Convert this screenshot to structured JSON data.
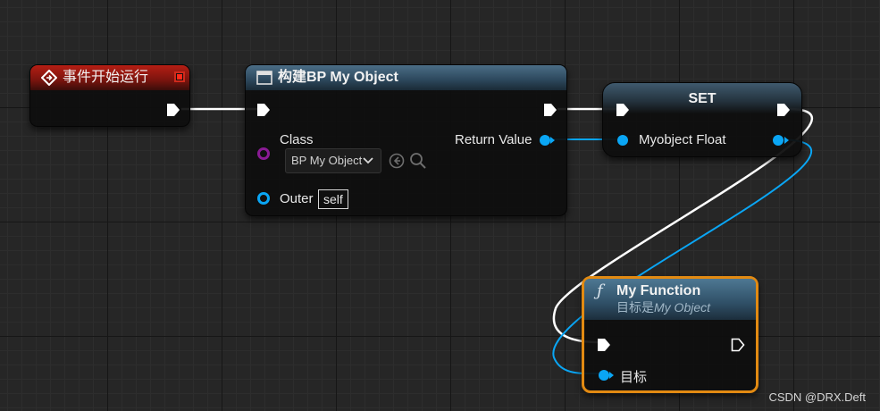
{
  "nodes": {
    "event": {
      "title": "事件开始运行"
    },
    "construct": {
      "title": "构建BP My Object",
      "class_label": "Class",
      "class_value": "BP My Object",
      "outer_label": "Outer",
      "outer_value": "self",
      "return_label": "Return Value"
    },
    "set": {
      "title": "SET",
      "var_label": "Myobject Float"
    },
    "func": {
      "title": "My Function",
      "subtitle_prefix": "目标是",
      "subtitle_target": "My Object",
      "target_label": "目标"
    }
  },
  "watermark": "CSDN @DRX.Deft",
  "colors": {
    "exec_wire": "#ffffff",
    "object_pin": "#0aa6f5",
    "class_pin": "#8a1b94",
    "event_header": "#b51e14",
    "func_border": "#e28a12"
  },
  "icons": {
    "event": "event-diamond-icon",
    "construct": "construct-window-icon",
    "func": "function-f-icon",
    "dropdown": "chevron-down-icon",
    "browse": "browse-arrow-icon",
    "search": "search-icon"
  }
}
